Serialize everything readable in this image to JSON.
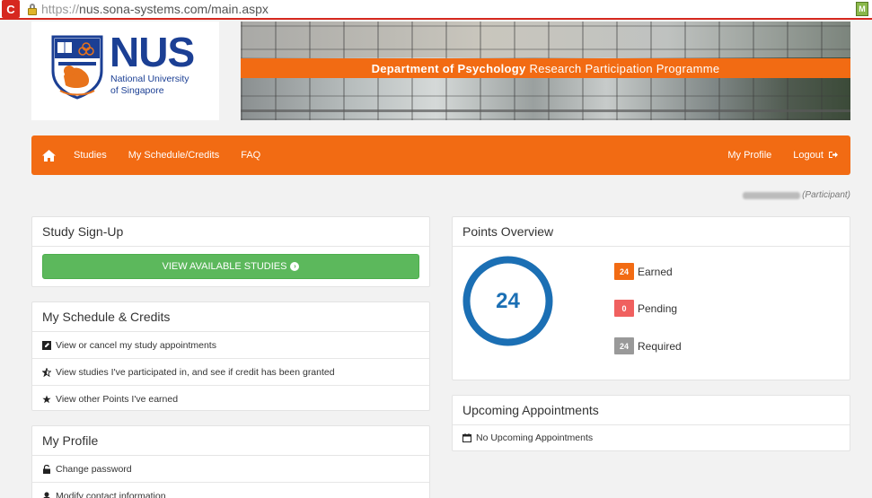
{
  "browser": {
    "url_protocol": "https://",
    "url_rest": "nus.sona-systems.com/main.aspx",
    "reload_glyph": "C",
    "ext_glyph": "M"
  },
  "logo": {
    "acronym": "NUS",
    "line1": "National University",
    "line2": "of Singapore"
  },
  "banner": {
    "dept_bold": "Department of Psychology",
    "dept_rest": "Research Participation Programme"
  },
  "nav": {
    "home_icon": "home-icon",
    "items": [
      "Studies",
      "My Schedule/Credits",
      "FAQ"
    ],
    "profile": "My Profile",
    "logout": "Logout",
    "logout_icon": "sign-out-icon"
  },
  "user": {
    "role": "(Participant)"
  },
  "signup": {
    "title": "Study Sign-Up",
    "button": "VIEW AVAILABLE STUDIES",
    "button_icon": "circle-arrow-right-icon"
  },
  "schedule": {
    "title": "My Schedule & Credits",
    "items": [
      {
        "icon": "edit-icon",
        "label": "View or cancel my study appointments"
      },
      {
        "icon": "half-star-icon",
        "label": "View studies I've participated in, and see if credit has been granted"
      },
      {
        "icon": "star-icon",
        "label": "View other Points I've earned"
      }
    ]
  },
  "profile": {
    "title": "My Profile",
    "items": [
      {
        "icon": "unlock-icon",
        "label": "Change password"
      },
      {
        "icon": "user-icon",
        "label": "Modify contact information"
      }
    ]
  },
  "points": {
    "title": "Points Overview",
    "total": "24",
    "progress_fraction": 1.0,
    "earned_value": "24",
    "earned_label": "Earned",
    "pending_value": "0",
    "pending_label": "Pending",
    "required_value": "24",
    "required_label": "Required"
  },
  "appointments": {
    "title": "Upcoming Appointments",
    "empty": "No Upcoming Appointments",
    "icon": "calendar-icon"
  },
  "colors": {
    "brand_orange": "#f26b13",
    "nus_blue": "#1b3f94",
    "donut_blue": "#1b6fb4",
    "success_green": "#5cb85c",
    "pending_red": "#f0605f",
    "required_gray": "#999999",
    "browser_red": "#d6281f"
  }
}
